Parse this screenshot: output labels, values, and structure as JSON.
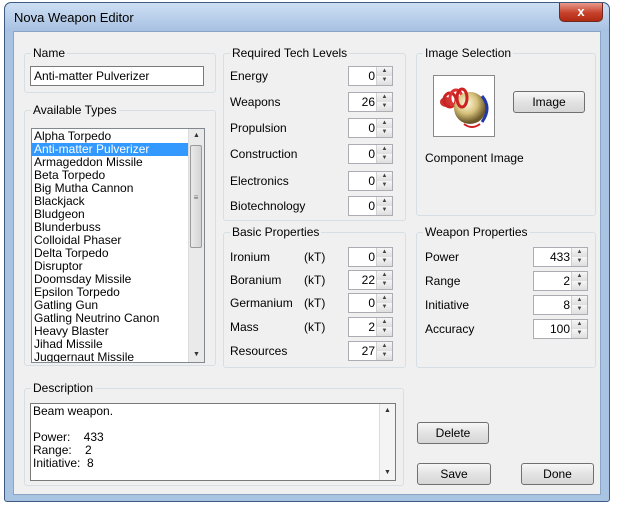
{
  "window": {
    "title": "Nova Weapon Editor",
    "close_label": "x"
  },
  "name_group": {
    "title": "Name",
    "value": "Anti-matter Pulverizer"
  },
  "types_group": {
    "title": "Available Types",
    "items": [
      "Alpha Torpedo",
      "Anti-matter Pulverizer",
      "Armageddon Missile",
      "Beta Torpedo",
      "Big Mutha Cannon",
      "Blackjack",
      "Bludgeon",
      "Blunderbuss",
      "Colloidal Phaser",
      "Delta Torpedo",
      "Disruptor",
      "Doomsday Missile",
      "Epsilon Torpedo",
      "Gatling Gun",
      "Gatling Neutrino Canon",
      "Heavy Blaster",
      "Jihad Missile",
      "Juggernaut Missile"
    ],
    "selected_index": 1
  },
  "tech_group": {
    "title": "Required Tech Levels",
    "rows": [
      {
        "label": "Energy",
        "value": "0"
      },
      {
        "label": "Weapons",
        "value": "26"
      },
      {
        "label": "Propulsion",
        "value": "0"
      },
      {
        "label": "Construction",
        "value": "0"
      },
      {
        "label": "Electronics",
        "value": "0"
      },
      {
        "label": "Biotechnology",
        "value": "0"
      }
    ]
  },
  "basic_group": {
    "title": "Basic Properties",
    "rows": [
      {
        "label": "Ironium",
        "unit": "(kT)",
        "value": "0"
      },
      {
        "label": "Boranium",
        "unit": "(kT)",
        "value": "22"
      },
      {
        "label": "Germanium",
        "unit": "(kT)",
        "value": "0"
      },
      {
        "label": "Mass",
        "unit": "(kT)",
        "value": "2"
      },
      {
        "label": "Resources",
        "unit": "",
        "value": "27"
      }
    ]
  },
  "image_group": {
    "title": "Image Selection",
    "button_label": "Image",
    "caption": "Component Image"
  },
  "weapon_group": {
    "title": "Weapon Properties",
    "rows": [
      {
        "label": "Power",
        "value": "433"
      },
      {
        "label": "Range",
        "value": "2"
      },
      {
        "label": "Initiative",
        "value": "8"
      },
      {
        "label": "Accuracy",
        "value": "100"
      }
    ]
  },
  "description_group": {
    "title": "Description",
    "lines": [
      "Beam weapon.",
      "",
      "Power:    433",
      "Range:    2",
      "Initiative:  8"
    ]
  },
  "buttons": {
    "delete": "Delete",
    "save": "Save",
    "done": "Done"
  },
  "colors": {
    "selection": "#3399ff",
    "title_close": "#c6412a"
  }
}
